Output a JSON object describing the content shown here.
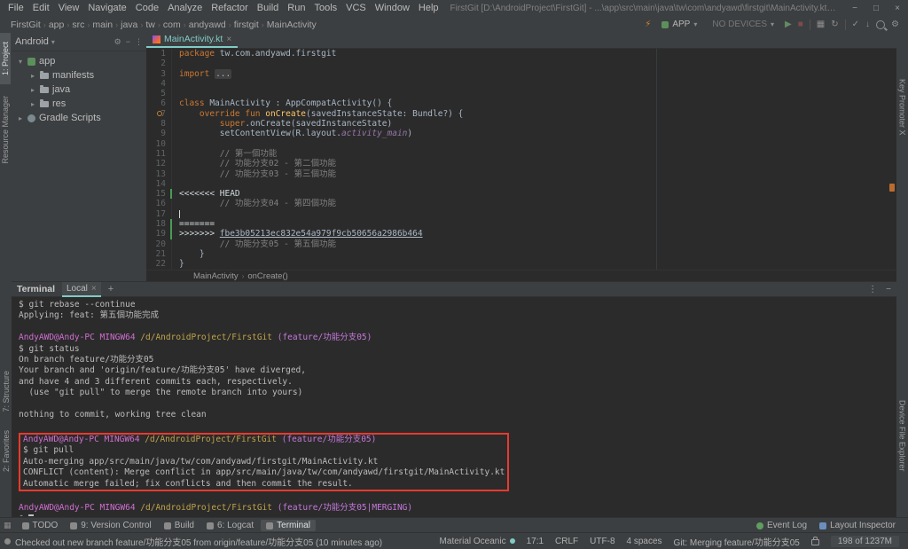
{
  "titlebar": {
    "menus": [
      "File",
      "Edit",
      "View",
      "Navigate",
      "Code",
      "Analyze",
      "Refactor",
      "Build",
      "Run",
      "Tools",
      "VCS",
      "Window",
      "Help"
    ],
    "title": "FirstGit [D:\\AndroidProject\\FirstGit] - ...\\app\\src\\main\\java\\tw\\com\\andyawd\\firstgit\\MainActivity.kt [app] - Android Studio"
  },
  "toolbar": {
    "breadcrumbs": [
      "FirstGit",
      "app",
      "src",
      "main",
      "java",
      "tw",
      "com",
      "andyawd",
      "firstgit",
      "MainActivity"
    ],
    "actions": [
      {
        "type": "icon",
        "name": "apply-changes-icon",
        "glyph": "⚡",
        "color": "#d0862f"
      },
      {
        "type": "chip",
        "name": "run-configuration-select",
        "label": "APP",
        "icon_color": "#5c8f5c"
      },
      {
        "type": "chip",
        "name": "device-select",
        "label": "NO DEVICES",
        "muted": true
      },
      {
        "type": "icon",
        "name": "run-icon",
        "glyph": "▶",
        "color": "#648b64"
      },
      {
        "type": "icon",
        "name": "stop-icon",
        "glyph": "■",
        "color": "#7d4b4b"
      },
      {
        "type": "sep"
      },
      {
        "type": "icon",
        "name": "avd-manager-icon",
        "glyph": "▦",
        "color": "#8d8d8d"
      },
      {
        "type": "icon",
        "name": "gradle-sync-icon",
        "glyph": "↻",
        "color": "#8d8d8d"
      },
      {
        "type": "sep"
      },
      {
        "type": "icon",
        "name": "commit-icon",
        "glyph": "✓",
        "color": "#8d8d8d"
      },
      {
        "type": "icon",
        "name": "update-project-icon",
        "glyph": "↓",
        "color": "#8d8d8d"
      },
      {
        "type": "search",
        "name": "search-everywhere-icon"
      },
      {
        "type": "icon",
        "name": "settings-icon",
        "glyph": "⚙",
        "color": "#8d8d8d"
      }
    ]
  },
  "left_strip": {
    "top": [
      {
        "name": "project",
        "label": "1: Project",
        "active": true
      },
      {
        "name": "resource-manager",
        "label": "Resource Manager"
      }
    ],
    "bottom": [
      {
        "name": "structure",
        "label": "7: Structure"
      },
      {
        "name": "favorites",
        "label": "2: Favorites"
      }
    ]
  },
  "right_strip": {
    "top": [
      {
        "name": "key-promoter-x",
        "label": "Key Promoter X"
      }
    ],
    "bottom": [
      {
        "name": "device-file-explorer",
        "label": "Device File Explorer"
      }
    ]
  },
  "project": {
    "view_selector": "Android",
    "tree": [
      {
        "label": "app",
        "level": 0,
        "expanded": true,
        "icon": "app-module"
      },
      {
        "label": "manifests",
        "level": 1,
        "expanded": false,
        "icon": "folder"
      },
      {
        "label": "java",
        "level": 1,
        "expanded": false,
        "icon": "folder"
      },
      {
        "label": "res",
        "level": 1,
        "expanded": false,
        "icon": "folder"
      },
      {
        "label": "Gradle Scripts",
        "level": 0,
        "expanded": false,
        "icon": "gradle"
      }
    ]
  },
  "editor": {
    "tab_label": "MainActivity.kt",
    "breadcrumb": [
      "MainActivity",
      "onCreate()"
    ],
    "lines": [
      {
        "n": 1,
        "segs": [
          {
            "c": "k",
            "t": "package"
          },
          {
            "c": "p",
            "t": " tw.com.andyawd.firstgit"
          }
        ]
      },
      {
        "n": 2,
        "segs": []
      },
      {
        "n": 3,
        "segs": [
          {
            "c": "k",
            "t": "import"
          },
          {
            "c": "p",
            "t": " "
          },
          {
            "c": "d",
            "t": "..."
          }
        ]
      },
      {
        "n": 4,
        "segs": []
      },
      {
        "n": 5,
        "segs": []
      },
      {
        "n": 6,
        "segs": [
          {
            "c": "k",
            "t": "class"
          },
          {
            "c": "p",
            "t": " MainActivity : AppCompatActivity() {"
          }
        ]
      },
      {
        "n": 7,
        "gicon": "override-icon",
        "segs": [
          {
            "c": "p",
            "t": "    "
          },
          {
            "c": "k",
            "t": "override fun "
          },
          {
            "c": "f",
            "t": "onCreate"
          },
          {
            "c": "p",
            "t": "(savedInstanceState: Bundle?) {"
          }
        ]
      },
      {
        "n": 8,
        "segs": [
          {
            "c": "p",
            "t": "        "
          },
          {
            "c": "k",
            "t": "super"
          },
          {
            "c": "p",
            "t": ".onCreate(savedInstanceState)"
          }
        ]
      },
      {
        "n": 9,
        "segs": [
          {
            "c": "p",
            "t": "        setContentView(R.layout."
          },
          {
            "c": "m",
            "t": "activity_main"
          },
          {
            "c": "p",
            "t": ")"
          }
        ]
      },
      {
        "n": 10,
        "segs": []
      },
      {
        "n": 11,
        "segs": [
          {
            "c": "c",
            "t": "        // 第一個功能"
          }
        ]
      },
      {
        "n": 12,
        "segs": [
          {
            "c": "c",
            "t": "        // 功能分支02 - 第二個功能"
          }
        ]
      },
      {
        "n": 13,
        "segs": [
          {
            "c": "c",
            "t": "        // 功能分支03 - 第三個功能"
          }
        ]
      },
      {
        "n": 14,
        "segs": []
      },
      {
        "n": 15,
        "changed": true,
        "segs": [
          {
            "c": "x",
            "t": "<<<<<<< HEAD"
          }
        ]
      },
      {
        "n": 16,
        "segs": [
          {
            "c": "c",
            "t": "        // 功能分支04 - 第四個功能"
          }
        ]
      },
      {
        "n": 17,
        "caret": true,
        "segs": []
      },
      {
        "n": 18,
        "changed": true,
        "segs": [
          {
            "c": "x",
            "t": "======="
          }
        ]
      },
      {
        "n": 19,
        "changed": true,
        "segs": [
          {
            "c": "x",
            "t": ">>>>>>> "
          },
          {
            "c": "h",
            "t": "fbe3b05213ec832e54a979f9cb50656a2986b464"
          }
        ]
      },
      {
        "n": 20,
        "segs": [
          {
            "c": "c",
            "t": "        // 功能分支05 - 第五個功能"
          }
        ]
      },
      {
        "n": 21,
        "segs": [
          {
            "c": "p",
            "t": "    }"
          }
        ]
      },
      {
        "n": 22,
        "segs": [
          {
            "c": "p",
            "t": "}"
          }
        ]
      }
    ]
  },
  "terminal": {
    "title": "Terminal",
    "tab_label": "Local",
    "lines": [
      {
        "segs": [
          {
            "c": "t",
            "t": "$ git rebase --continue"
          }
        ]
      },
      {
        "segs": [
          {
            "c": "t",
            "t": "Applying: feat: 第五個功能完成"
          }
        ]
      },
      {
        "segs": []
      },
      {
        "segs": [
          {
            "c": "u",
            "t": "AndyAWD@Andy-PC MINGW64 "
          },
          {
            "c": "y",
            "t": "/d/AndroidProject/FirstGit "
          },
          {
            "c": "b",
            "t": "(feature/功能分支05)"
          }
        ]
      },
      {
        "segs": [
          {
            "c": "t",
            "t": "$ git status"
          }
        ]
      },
      {
        "segs": [
          {
            "c": "t",
            "t": "On branch feature/功能分支05"
          }
        ]
      },
      {
        "segs": [
          {
            "c": "t",
            "t": "Your branch and 'origin/feature/功能分支05' have diverged,"
          }
        ]
      },
      {
        "segs": [
          {
            "c": "t",
            "t": "and have 4 and 3 different commits each, respectively."
          }
        ]
      },
      {
        "segs": [
          {
            "c": "t",
            "t": "  (use \"git pull\" to merge the remote branch into yours)"
          }
        ]
      },
      {
        "segs": []
      },
      {
        "segs": [
          {
            "c": "t",
            "t": "nothing to commit, working tree clean"
          }
        ]
      },
      {
        "segs": []
      },
      {
        "box": true,
        "segs": [
          {
            "c": "u",
            "t": "AndyAWD@Andy-PC MINGW64 "
          },
          {
            "c": "y",
            "t": "/d/AndroidProject/FirstGit "
          },
          {
            "c": "b",
            "t": "(feature/功能分支05)"
          }
        ]
      },
      {
        "box": true,
        "segs": [
          {
            "c": "t",
            "t": "$ git pull"
          }
        ]
      },
      {
        "box": true,
        "segs": [
          {
            "c": "t",
            "t": "Auto-merging app/src/main/java/tw/com/andyawd/firstgit/MainActivity.kt"
          }
        ]
      },
      {
        "box": true,
        "segs": [
          {
            "c": "t",
            "t": "CONFLICT (content): Merge conflict in app/src/main/java/tw/com/andyawd/firstgit/MainActivity.kt"
          }
        ]
      },
      {
        "box": true,
        "segs": [
          {
            "c": "t",
            "t": "Automatic merge failed; fix conflicts and then commit the result."
          }
        ]
      },
      {
        "segs": []
      },
      {
        "segs": [
          {
            "c": "u",
            "t": "AndyAWD@Andy-PC MINGW64 "
          },
          {
            "c": "y",
            "t": "/d/AndroidProject/FirstGit "
          },
          {
            "c": "b",
            "t": "(feature/功能分支05|MERGING)"
          }
        ]
      },
      {
        "segs": [
          {
            "c": "t",
            "t": "$ "
          },
          {
            "c": "cur",
            "t": " "
          }
        ]
      }
    ]
  },
  "bottom_bar": {
    "left": [
      {
        "name": "todo",
        "label": "TODO",
        "icon": "todo-icon"
      },
      {
        "name": "version-control",
        "label": "9: Version Control",
        "icon": "version-control-icon"
      },
      {
        "name": "build",
        "label": "Build",
        "icon": "build-icon"
      },
      {
        "name": "logcat",
        "label": "6: Logcat",
        "icon": "logcat-icon"
      },
      {
        "name": "terminal",
        "label": "Terminal",
        "icon": "terminal-icon",
        "active": true
      }
    ],
    "right": [
      {
        "name": "event-log",
        "label": "Event Log",
        "icon": "event-log-icon",
        "icon_class": "green"
      },
      {
        "name": "layout-inspector",
        "label": "Layout Inspector",
        "icon": "layout-inspector-icon",
        "icon_class": "blue"
      }
    ]
  },
  "status_bar": {
    "message": "Checked out new branch feature/功能分支05 from origin/feature/功能分支05 (10 minutes ago)",
    "right": [
      {
        "name": "theme-widget",
        "label": "Material Oceanic",
        "dot": "#80cbc4"
      },
      {
        "name": "caret-position",
        "label": "17:1"
      },
      {
        "name": "line-separator",
        "label": "CRLF"
      },
      {
        "name": "file-encoding",
        "label": "UTF-8"
      },
      {
        "name": "indent-style",
        "label": "4 spaces"
      },
      {
        "name": "git-branch-widget",
        "label": "Git: Merging feature/功能分支05"
      },
      {
        "name": "readonly-lock",
        "lock": true
      },
      {
        "name": "memory-indicator",
        "label": "198 of 1237M",
        "mem": true
      }
    ]
  },
  "colors": {
    "accent": "#80cbc4",
    "conflict_box": "#e93a2e",
    "changed_gutter": "#499c54",
    "error_stripe": "#bb6b2d"
  }
}
